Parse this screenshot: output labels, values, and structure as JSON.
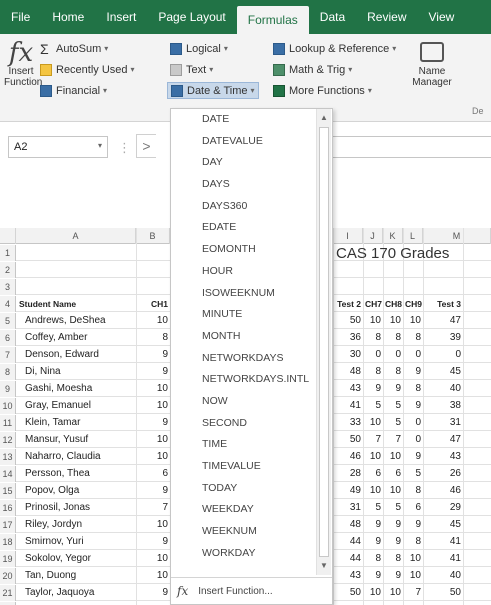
{
  "ribbon_tabs": [
    "File",
    "Home",
    "Insert",
    "Page Layout",
    "Formulas",
    "Data",
    "Review",
    "View"
  ],
  "active_tab": "Formulas",
  "ribbon": {
    "insert_function": {
      "line1": "Insert",
      "line2": "Function"
    },
    "autosum": "AutoSum",
    "recently_used": "Recently Used",
    "financial": "Financial",
    "logical": "Logical",
    "text": "Text",
    "date_time": "Date & Time",
    "lookup": "Lookup & Reference",
    "math": "Math & Trig",
    "more": "More Functions",
    "name_manager": {
      "line1": "Name",
      "line2": "Manager"
    },
    "partial_group": "De"
  },
  "name_box": "A2",
  "formula_bar_partial": ">",
  "column_headers": [
    "A",
    "B",
    "I",
    "J",
    "K",
    "L",
    "M"
  ],
  "sheet_title": "CAS 170 Grades",
  "row_numbers": [
    "1",
    "2",
    "3",
    "4",
    "5",
    "6",
    "7",
    "8",
    "9",
    "10",
    "11",
    "12",
    "13",
    "14",
    "15",
    "16",
    "17",
    "18",
    "19",
    "20",
    "21",
    "22"
  ],
  "table": {
    "headers": {
      "name": "Student Name",
      "ch1": "CH1",
      "test2": "Test 2",
      "ch7": "CH7",
      "ch8": "CH8",
      "ch9": "CH9",
      "test3": "Test 3"
    },
    "rows": [
      {
        "name": "Andrews, DeShea",
        "ch1": "10",
        "test2": "50",
        "ch7": "10",
        "ch8": "10",
        "ch9": "10",
        "test3": "47"
      },
      {
        "name": "Coffey, Amber",
        "ch1": "8",
        "test2": "36",
        "ch7": "8",
        "ch8": "8",
        "ch9": "8",
        "test3": "39"
      },
      {
        "name": "Denson, Edward",
        "ch1": "9",
        "test2": "30",
        "ch7": "0",
        "ch8": "0",
        "ch9": "0",
        "test3": "0"
      },
      {
        "name": "Di, Nina",
        "ch1": "9",
        "test2": "48",
        "ch7": "8",
        "ch8": "8",
        "ch9": "9",
        "test3": "45"
      },
      {
        "name": "Gashi, Moesha",
        "ch1": "10",
        "test2": "43",
        "ch7": "9",
        "ch8": "9",
        "ch9": "8",
        "test3": "40"
      },
      {
        "name": "Gray, Emanuel",
        "ch1": "10",
        "test2": "41",
        "ch7": "5",
        "ch8": "5",
        "ch9": "9",
        "test3": "38"
      },
      {
        "name": "Klein, Tamar",
        "ch1": "9",
        "test2": "33",
        "ch7": "10",
        "ch8": "5",
        "ch9": "0",
        "test3": "31"
      },
      {
        "name": "Mansur, Yusuf",
        "ch1": "10",
        "test2": "50",
        "ch7": "7",
        "ch8": "7",
        "ch9": "0",
        "test3": "47"
      },
      {
        "name": "Naharro, Claudia",
        "ch1": "10",
        "test2": "46",
        "ch7": "10",
        "ch8": "10",
        "ch9": "9",
        "test3": "43"
      },
      {
        "name": "Persson, Thea",
        "ch1": "6",
        "test2": "28",
        "ch7": "6",
        "ch8": "6",
        "ch9": "5",
        "test3": "26"
      },
      {
        "name": "Popov, Olga",
        "ch1": "9",
        "test2": "49",
        "ch7": "10",
        "ch8": "10",
        "ch9": "8",
        "test3": "46"
      },
      {
        "name": "Prinosil, Jonas",
        "ch1": "7",
        "test2": "31",
        "ch7": "5",
        "ch8": "5",
        "ch9": "6",
        "test3": "29"
      },
      {
        "name": "Riley, Jordyn",
        "ch1": "10",
        "test2": "48",
        "ch7": "9",
        "ch8": "9",
        "ch9": "9",
        "test3": "45"
      },
      {
        "name": "Smirnov, Yuri",
        "ch1": "9",
        "test2": "44",
        "ch7": "9",
        "ch8": "9",
        "ch9": "8",
        "test3": "41"
      },
      {
        "name": "Sokolov, Yegor",
        "ch1": "10",
        "test2": "44",
        "ch7": "8",
        "ch8": "8",
        "ch9": "10",
        "test3": "41"
      },
      {
        "name": "Tan, Duong",
        "ch1": "10",
        "test2": "43",
        "ch7": "9",
        "ch8": "9",
        "ch9": "10",
        "test3": "40"
      },
      {
        "name": "Taylor, Jaquoya",
        "ch1": "9",
        "test2": "50",
        "ch7": "10",
        "ch8": "10",
        "ch9": "7",
        "test3": "50"
      }
    ]
  },
  "dropdown": {
    "items": [
      "DATE",
      "DATEVALUE",
      "DAY",
      "DAYS",
      "DAYS360",
      "EDATE",
      "EOMONTH",
      "HOUR",
      "ISOWEEKNUM",
      "MINUTE",
      "MONTH",
      "NETWORKDAYS",
      "NETWORKDAYS.INTL",
      "NOW",
      "SECOND",
      "TIME",
      "TIMEVALUE",
      "TODAY",
      "WEEKDAY",
      "WEEKNUM",
      "WORKDAY"
    ],
    "footer": "Insert Function..."
  },
  "colors": {
    "excel_green": "#217346",
    "ribbon_bg": "#f3f3f3",
    "selected_item": "#c8d8ea"
  }
}
